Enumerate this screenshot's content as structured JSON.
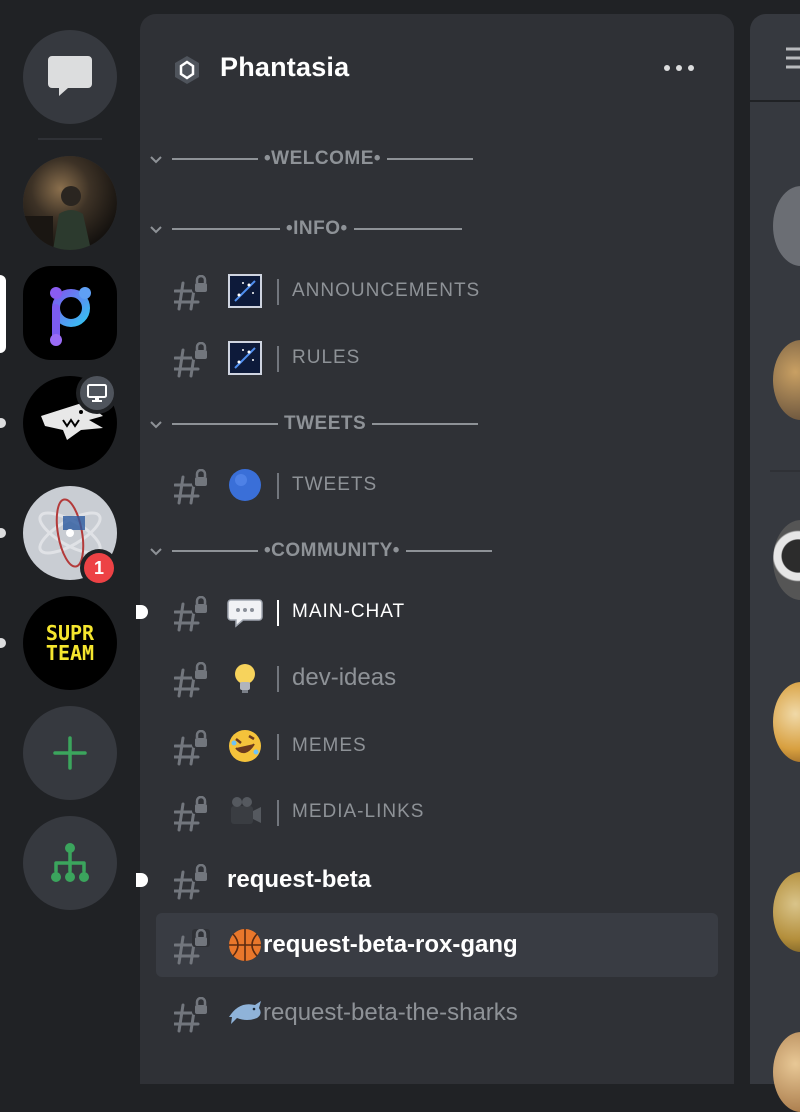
{
  "server": {
    "name": "Phantasia",
    "more_label": "•••"
  },
  "rail": {
    "items": [
      {
        "id": "direct-messages",
        "icon": "chat-bubble-icon"
      },
      {
        "id": "server-photo"
      },
      {
        "id": "server-phantasia",
        "active": true
      },
      {
        "id": "server-shark",
        "status": "streaming"
      },
      {
        "id": "server-atom",
        "mentions": "1"
      },
      {
        "id": "server-supr-team",
        "label_line1": "SUPR",
        "label_line2": "TEAM"
      },
      {
        "id": "add-server",
        "icon": "plus-icon"
      },
      {
        "id": "explore-servers",
        "icon": "hierarchy-icon"
      }
    ]
  },
  "categories": [
    {
      "label": "•WELCOME•"
    },
    {
      "label": "•INFO•"
    },
    {
      "label": "TWEETS"
    },
    {
      "label": "•COMMUNITY•"
    }
  ],
  "channels": [
    {
      "name": "ANNOUNCEMENTS",
      "emoji": "stars"
    },
    {
      "name": "RULES",
      "emoji": "stars"
    },
    {
      "name": "TWEETS",
      "emoji": "blue-circle"
    },
    {
      "name": "MAIN-CHAT",
      "emoji": "speech-balloon",
      "unread": true
    },
    {
      "name": "dev-ideas",
      "emoji": "light-bulb"
    },
    {
      "name": "MEMES",
      "emoji": "rofl"
    },
    {
      "name": "MEDIA-LINKS",
      "emoji": "movie-camera"
    },
    {
      "name": "request-beta",
      "unread": true
    },
    {
      "name": "request-beta-rox-gang",
      "emoji": "basketball",
      "prefix": "🏀",
      "selected": true
    },
    {
      "name": "request-beta-the-sharks",
      "emoji": "dolphin",
      "prefix": "🐬"
    }
  ],
  "colors": {
    "background": "#202225",
    "panel": "#2f3136",
    "selected": "#393c43",
    "muted_text": "#8e9297",
    "accent_green": "#3ba55d",
    "mention_red": "#ed4245"
  }
}
